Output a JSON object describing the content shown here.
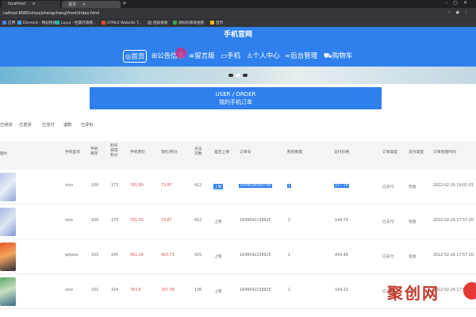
{
  "browser": {
    "tabs": [
      {
        "title": "localhost"
      },
      {
        "title": "首页"
      }
    ],
    "url": "calhost:8080/shoujishangcheng/front/index.html",
    "bookmarks": [
      {
        "label": "应用",
        "color": "#4285f4"
      },
      {
        "label": "Element - 网站快速...",
        "color": "#409eff"
      },
      {
        "label": "Layui - 经典开源模...",
        "color": "#16baaa"
      },
      {
        "label": "HTML5 Website T...",
        "color": "#e34c26"
      },
      {
        "label": "搜索接收",
        "color": "#777777"
      },
      {
        "label": "源码码库收视频",
        "color": "#34a853"
      },
      {
        "label": "首页",
        "color": "#fbbc05"
      }
    ]
  },
  "site": {
    "title": "手机官网",
    "nav": [
      {
        "label": "首页",
        "icon": "home-icon"
      },
      {
        "label": "公告信息",
        "icon": "notice-icon"
      },
      {
        "label": "留言版",
        "icon": "message-icon"
      },
      {
        "label": "手机",
        "icon": "phone-icon"
      },
      {
        "label": "个人中心",
        "icon": "user-icon"
      },
      {
        "label": "后台管理",
        "icon": "link-icon"
      },
      {
        "label": "购物车",
        "icon": "cart-icon"
      }
    ]
  },
  "order": {
    "line1": "USER / ORDER",
    "line2": "我的手机订单"
  },
  "filters": [
    "已收货",
    "已发货",
    "已支付",
    "退款",
    "已评价"
  ],
  "table": {
    "headers": [
      "图片",
      "手机型号",
      "手机库存",
      "购买获得积分",
      "手机原价",
      "现价/积分",
      "点击次数",
      "是否上架",
      "订单号",
      "购买数量",
      "支付价格",
      "订单类型",
      "支付类型",
      "订单创建时间"
    ],
    "rows": [
      {
        "model": "vivo",
        "stock": "100",
        "points": "173",
        "orig": "781.00",
        "price": "73.87",
        "clicks": "412",
        "status": "上架",
        "order_no": "1649036090799",
        "qty": "1",
        "pay": "217.18",
        "otype": "已支付",
        "ptype": "现金",
        "time": "2022-02-26 19:01:01"
      },
      {
        "model": "vivo",
        "stock": "100",
        "points": "173",
        "orig": "781.00",
        "price": "73.87",
        "clicks": "412",
        "status": "上架",
        "order_no": "1649042239925",
        "qty": "2",
        "pay": "144.79",
        "otype": "已支付",
        "ptype": "现金",
        "time": "2022-02-26 17:57:20"
      },
      {
        "model": "iphone",
        "stock": "103",
        "points": "245",
        "orig": "961.24",
        "price": "463.73",
        "clicks": "425",
        "status": "上架",
        "order_no": "1649042239925",
        "qty": "1",
        "pay": "454.46",
        "otype": "已支付",
        "ptype": "现金",
        "time": "2022-02-26 17:57:20"
      },
      {
        "model": "vivo",
        "stock": "101",
        "points": "324",
        "orig": "763.6",
        "price": "167.58",
        "clicks": "136",
        "status": "上架",
        "order_no": "1649042239925",
        "qty": "1",
        "pay": "164.23",
        "otype": "已支付",
        "ptype": "现金",
        "time": "2022-02-26 17:57:20"
      }
    ]
  },
  "watermark": "聚创网",
  "colors": {
    "brand": "#2f80ed",
    "price": "#d9534f",
    "chrome": "#35363a"
  }
}
